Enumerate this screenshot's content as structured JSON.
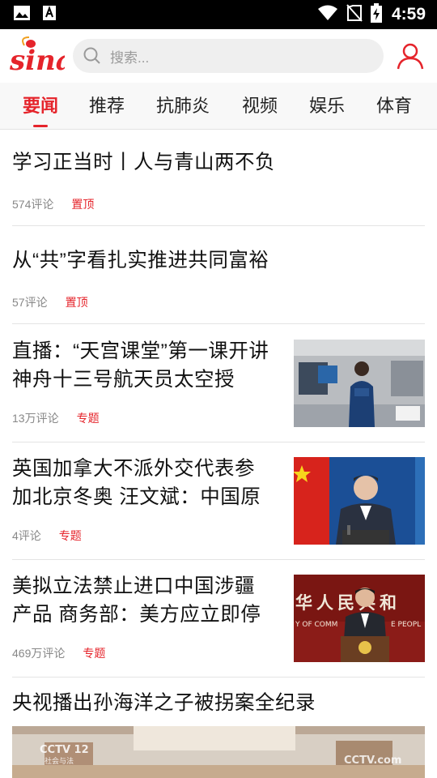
{
  "status_bar": {
    "time": "4:59",
    "left_icons": [
      "image-icon",
      "a-notification-icon"
    ],
    "right_icons": [
      "wifi-icon",
      "no-sim-icon",
      "battery-charging-icon"
    ]
  },
  "header": {
    "logo_text": "sina",
    "search_placeholder": "搜索...",
    "brand_color": "#e5242b"
  },
  "tabs": [
    {
      "label": "要闻",
      "active": true
    },
    {
      "label": "推荐",
      "active": false
    },
    {
      "label": "抗肺炎",
      "active": false
    },
    {
      "label": "视频",
      "active": false
    },
    {
      "label": "娱乐",
      "active": false
    },
    {
      "label": "体育",
      "active": false
    }
  ],
  "news": [
    {
      "title": "学习正当时丨人与青山两不负",
      "comments": "574评论",
      "tag": "置顶"
    },
    {
      "title": "从“共”字看扎实推进共同富裕",
      "comments": "57评论",
      "tag": "置顶"
    },
    {
      "title_line1": "直播：“天宫课堂”第一课开讲",
      "title_line2": "神舟十三号航天员太空授",
      "comments": "13万评论",
      "tag": "专题",
      "image": "astronaut-in-space-station"
    },
    {
      "title_line1": "英国加拿大不派外交代表参",
      "title_line2": "加北京冬奥 汪文斌：中国原",
      "comments": "4评论",
      "tag": "专题",
      "image": "spokesman-press-conference"
    },
    {
      "title_line1": "美拟立法禁止进口中国涉疆",
      "title_line2": "产品 商务部：美方应立即停",
      "comments": "469万评论",
      "tag": "专题",
      "image": "ministry-of-commerce-press-conference",
      "image_banner_text": "华人民共和",
      "image_banner_sub_left": "Y OF COMM",
      "image_banner_sub_right": "E PEOPL"
    },
    {
      "title": "央视播出孙海洋之子被拐案全纪录",
      "image": "cctv-broadcast-still",
      "image_logo_left": "CCTV 12",
      "image_logo_left_sub": "社会与法",
      "image_logo_right": "CCTV.com"
    }
  ]
}
